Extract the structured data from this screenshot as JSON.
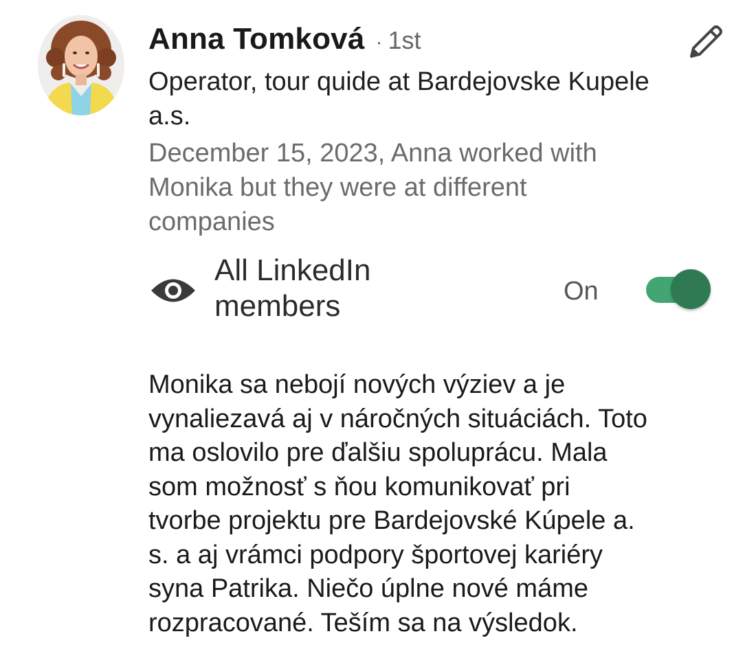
{
  "recommender": {
    "name": "Anna Tomková",
    "separator": "·",
    "connection_degree": "1st",
    "headline": "Operator, tour quide at Bardejovske Kupele a.s.",
    "meta": "December 15, 2023, Anna worked with Monika but they were at different companies",
    "avatar_icon": "profile-photo"
  },
  "visibility": {
    "icon": "eye-icon",
    "label": "All LinkedIn members",
    "toggle_state_label": "On",
    "toggle_on": true,
    "toggle_track_color": "#43a672",
    "toggle_thumb_color": "#2f7a53"
  },
  "actions": {
    "edit_icon": "pencil-icon"
  },
  "recommendation_text": "Monika sa nebojí nových výziev a je\nvynaliezavá aj v náročných situáciách. Toto\nma oslovilo pre ďalšiu spoluprácu. Mala\nsom možnosť s ňou komunikovať pri\ntvorbe projektu pre Bardejovské Kúpele a.\ns. a aj  vrámci podpory športovej kariéry\nsyna Patrika. Niečo úplne nové máme\nrozpracované. Teším sa na výsledok."
}
